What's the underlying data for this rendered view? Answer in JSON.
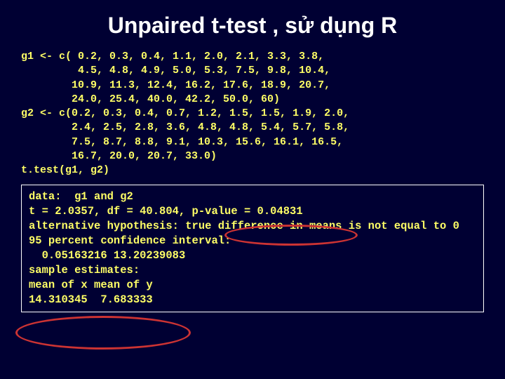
{
  "title": "Unpaired t-test , sử dụng R",
  "code": "g1 <- c( 0.2, 0.3, 0.4, 1.1, 2.0, 2.1, 3.3, 3.8,\n         4.5, 4.8, 4.9, 5.0, 5.3, 7.5, 9.8, 10.4,\n        10.9, 11.3, 12.4, 16.2, 17.6, 18.9, 20.7,\n        24.0, 25.4, 40.0, 42.2, 50.0, 60)\ng2 <- c(0.2, 0.3, 0.4, 0.7, 1.2, 1.5, 1.5, 1.9, 2.0,\n        2.4, 2.5, 2.8, 3.6, 4.8, 4.8, 5.4, 5.7, 5.8,\n        7.5, 8.7, 8.8, 9.1, 10.3, 15.6, 16.1, 16.5,\n        16.7, 20.0, 20.7, 33.0)\nt.test(g1, g2)",
  "output": "data:  g1 and g2\nt = 2.0357, df = 40.804, p-value = 0.04831\nalternative hypothesis: true difference in means is not equal to 0\n95 percent confidence interval:\n  0.05163216 13.20239083\nsample estimates:\nmean of x mean of y\n14.310345  7.683333"
}
